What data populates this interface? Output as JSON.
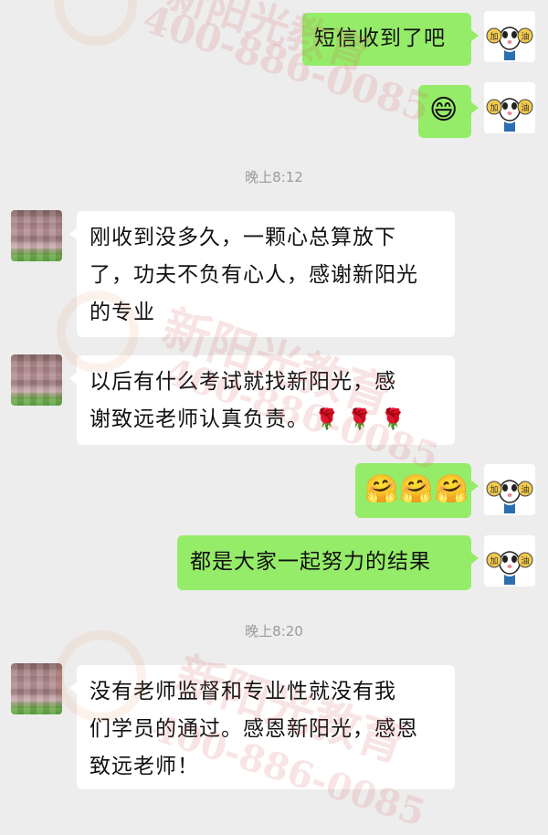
{
  "messages": {
    "m1": "短信收到了吧",
    "m2": "😄",
    "time1": "晚上8:12",
    "m3_l1": "刚收到没多久，一颗心总算放下",
    "m3_l2": "了，功夫不负有心人，感谢新阳光",
    "m3_l3": "的专业",
    "m4_l1": "以后有什么考试就找新阳光，感",
    "m4_l2": "谢致远老师认真负责。",
    "m4_roses": "🌹 🌹 🌹",
    "m5": "🤗🤗🤗",
    "m6": "都是大家一起努力的结果",
    "time2": "晚上8:20",
    "m7_l1": "没有老师监督和专业性就没有我",
    "m7_l2": "们学员的通过。感恩新阳光，感恩",
    "m7_l3": "致远老师！"
  },
  "avatar": {
    "my_avatar_label": "加油",
    "my_avatar_left": "加",
    "my_avatar_right": "油"
  },
  "watermark": {
    "brand": "新阳光教育",
    "phone": "400-886-0085"
  },
  "colors": {
    "background": "#ededed",
    "my_bubble": "#95ec69",
    "other_bubble": "#ffffff",
    "timestamp": "#9a9a9a"
  }
}
